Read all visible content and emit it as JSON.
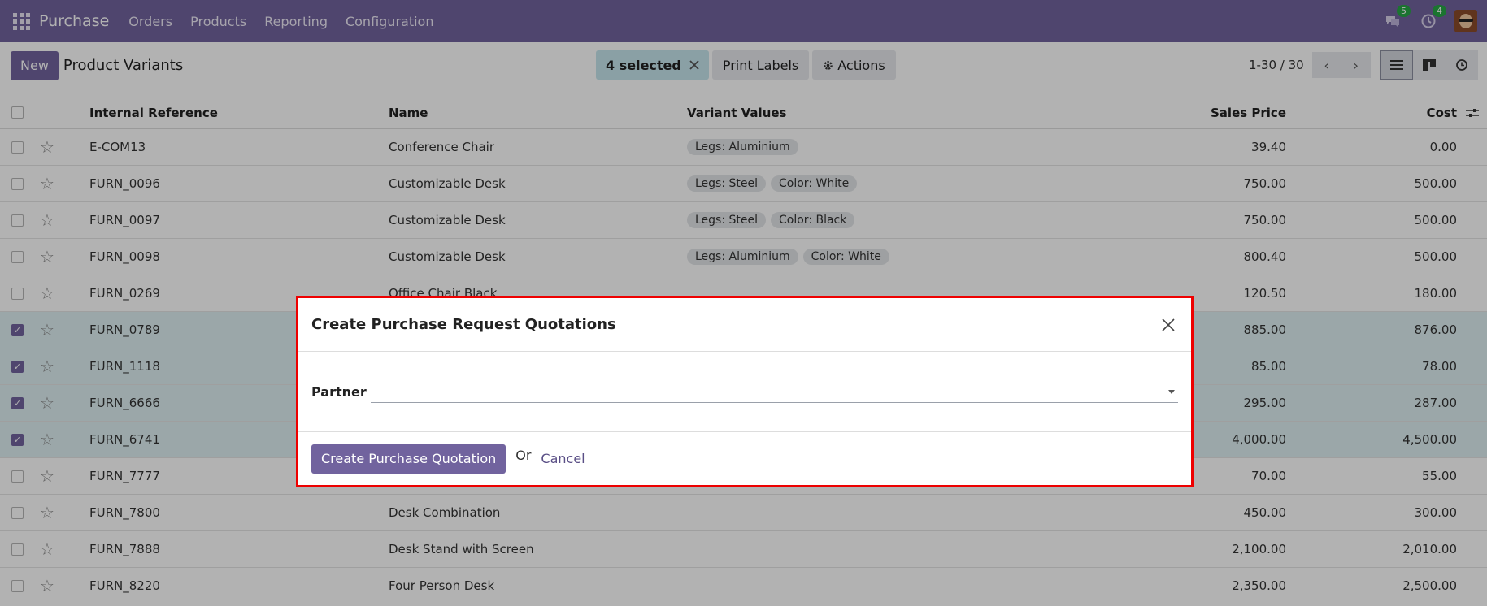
{
  "navbar": {
    "brand": "Purchase",
    "menu": [
      "Orders",
      "Products",
      "Reporting",
      "Configuration"
    ],
    "chat_count": "5",
    "activity_count": "4"
  },
  "control": {
    "new_label": "New",
    "title": "Product Variants",
    "selected_label": "4 selected",
    "print_labels": "Print Labels",
    "actions": "Actions",
    "pager": "1-30 / 30"
  },
  "table": {
    "headers": {
      "ref": "Internal Reference",
      "name": "Name",
      "variants": "Variant Values",
      "price": "Sales Price",
      "cost": "Cost"
    },
    "rows": [
      {
        "ref": "E-COM13",
        "name": "Conference Chair",
        "tags": [
          "Legs: Aluminium"
        ],
        "price": "39.40",
        "cost": "0.00",
        "selected": false
      },
      {
        "ref": "FURN_0096",
        "name": "Customizable Desk",
        "tags": [
          "Legs: Steel",
          "Color: White"
        ],
        "price": "750.00",
        "cost": "500.00",
        "selected": false
      },
      {
        "ref": "FURN_0097",
        "name": "Customizable Desk",
        "tags": [
          "Legs: Steel",
          "Color: Black"
        ],
        "price": "750.00",
        "cost": "500.00",
        "selected": false
      },
      {
        "ref": "FURN_0098",
        "name": "Customizable Desk",
        "tags": [
          "Legs: Aluminium",
          "Color: White"
        ],
        "price": "800.40",
        "cost": "500.00",
        "selected": false
      },
      {
        "ref": "FURN_0269",
        "name": "Office Chair Black",
        "tags": [],
        "price": "120.50",
        "cost": "180.00",
        "selected": false
      },
      {
        "ref": "FURN_0789",
        "name": "",
        "tags": [],
        "price": "885.00",
        "cost": "876.00",
        "selected": true
      },
      {
        "ref": "FURN_1118",
        "name": "",
        "tags": [],
        "price": "85.00",
        "cost": "78.00",
        "selected": true
      },
      {
        "ref": "FURN_6666",
        "name": "",
        "tags": [],
        "price": "295.00",
        "cost": "287.00",
        "selected": true
      },
      {
        "ref": "FURN_6741",
        "name": "",
        "tags": [],
        "price": "4,000.00",
        "cost": "4,500.00",
        "selected": true
      },
      {
        "ref": "FURN_7777",
        "name": "",
        "tags": [],
        "price": "70.00",
        "cost": "55.00",
        "selected": false
      },
      {
        "ref": "FURN_7800",
        "name": "Desk Combination",
        "tags": [],
        "price": "450.00",
        "cost": "300.00",
        "selected": false
      },
      {
        "ref": "FURN_7888",
        "name": "Desk Stand with Screen",
        "tags": [],
        "price": "2,100.00",
        "cost": "2,010.00",
        "selected": false
      },
      {
        "ref": "FURN_8220",
        "name": "Four Person Desk",
        "tags": [],
        "price": "2,350.00",
        "cost": "2,500.00",
        "selected": false
      }
    ]
  },
  "modal": {
    "title": "Create Purchase Request Quotations",
    "partner_label": "Partner",
    "partner_value": "",
    "create_label": "Create Purchase Quotation",
    "or_label": "Or",
    "cancel_label": "Cancel"
  },
  "colors": {
    "brand": "#71639e",
    "selected_row": "#dff0f3",
    "highlight_border": "#ee0000"
  }
}
